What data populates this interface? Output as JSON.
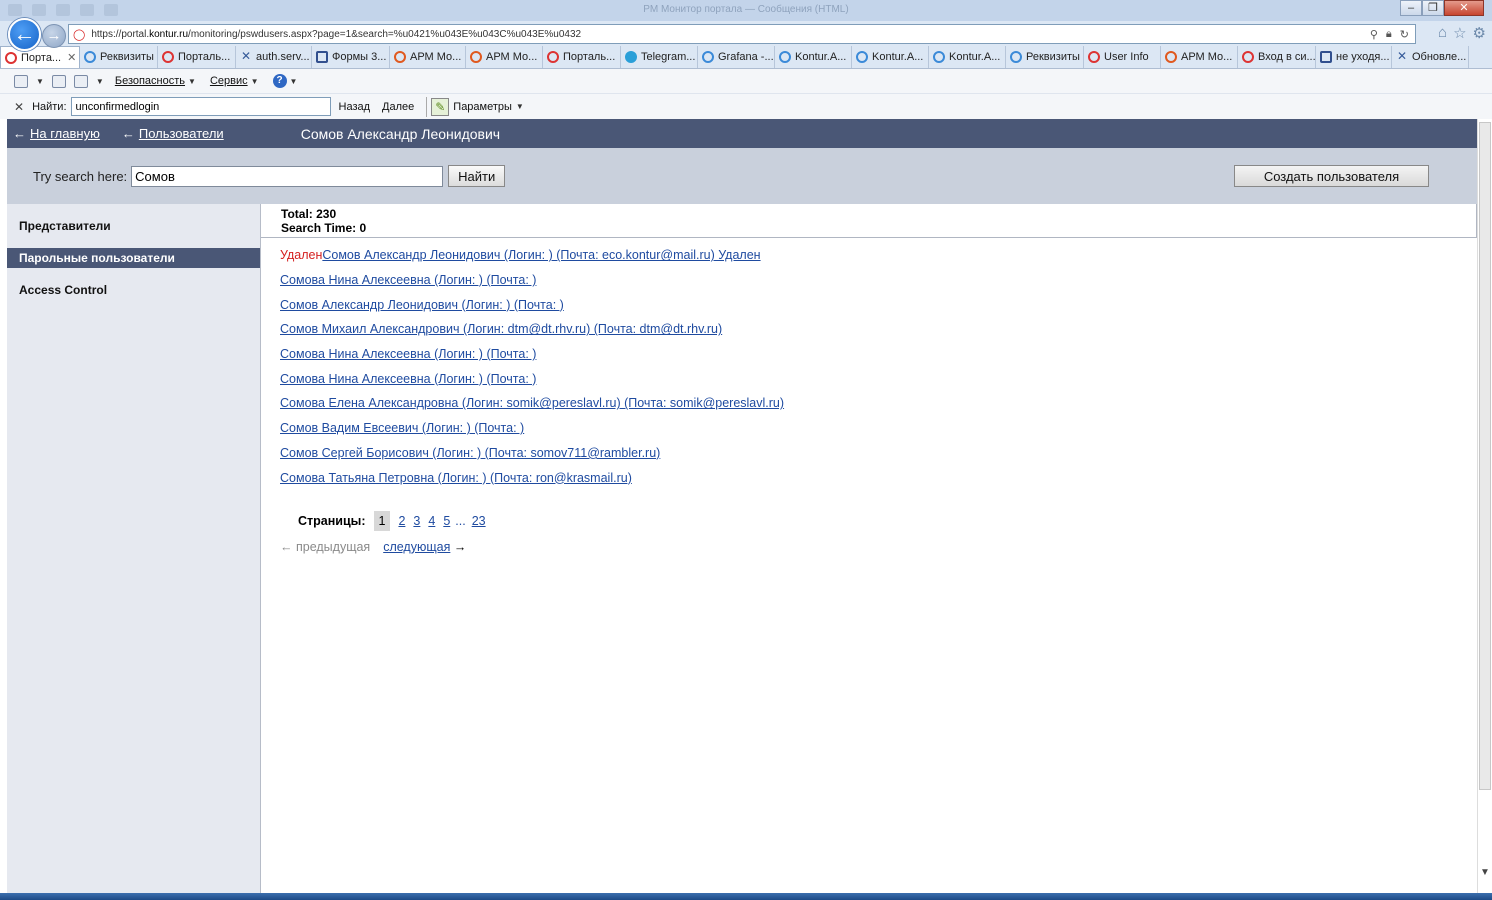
{
  "browser": {
    "window_title": "РМ Монитор портала — Сообщения (HTML)",
    "url_prefix": "https://portal.",
    "url_domain": "kontur.ru",
    "url_path": "/monitoring/pswdusers.aspx?page=1&search=%u0421%u043E%u043C%u043E%u0432",
    "tabs": [
      {
        "label": "Порта...",
        "icon": "portal-icon",
        "active": true
      },
      {
        "label": "Реквизиты",
        "icon": "ie-icon"
      },
      {
        "label": "Порталь...",
        "icon": "portal-icon"
      },
      {
        "label": "auth.serv...",
        "icon": "kontur-x-icon"
      },
      {
        "label": "Формы 3...",
        "icon": "form-icon"
      },
      {
        "label": "АРМ Мо...",
        "icon": "arm-icon"
      },
      {
        "label": "АРМ Мо...",
        "icon": "arm-icon"
      },
      {
        "label": "Порталь...",
        "icon": "portal-icon"
      },
      {
        "label": "Telegram...",
        "icon": "telegram-icon"
      },
      {
        "label": "Grafana -...",
        "icon": "ie-icon"
      },
      {
        "label": "Kontur.A...",
        "icon": "ie-icon"
      },
      {
        "label": "Kontur.A...",
        "icon": "ie-icon"
      },
      {
        "label": "Kontur.A...",
        "icon": "ie-icon"
      },
      {
        "label": "Реквизиты",
        "icon": "ie-icon"
      },
      {
        "label": "User Info",
        "icon": "portal-icon"
      },
      {
        "label": "АРМ Мо...",
        "icon": "arm-icon"
      },
      {
        "label": "Вход в си...",
        "icon": "portal-icon"
      },
      {
        "label": "не уходя...",
        "icon": "form-icon"
      },
      {
        "label": "Обновле...",
        "icon": "kontur-x-icon"
      }
    ],
    "commands": {
      "security": "Безопасность",
      "service": "Сервис"
    },
    "find": {
      "label": "Найти:",
      "value": "unconfirmedlogin",
      "back": "Назад",
      "next": "Далее",
      "params": "Параметры"
    }
  },
  "header": {
    "home_link": "На главную",
    "users_link": "Пользователи",
    "title": "Сомов Александр Леонидович"
  },
  "search": {
    "label": "Try search here:",
    "value": "Сомов",
    "button": "Найти",
    "create_button": "Создать пользователя"
  },
  "sidebar": {
    "items": [
      {
        "label": "Представители",
        "active": false
      },
      {
        "label": "Парольные пользователи",
        "active": true
      },
      {
        "label": "Access Control",
        "active": false
      }
    ]
  },
  "stats": {
    "total": "Total: 230",
    "search_time": "Search Time: 0"
  },
  "results": [
    {
      "deleted_prefix": "Удален",
      "text": "Сомов Александр Леонидович (Логин: ) (Почта: eco.kontur@mail.ru) Удален"
    },
    {
      "deleted_prefix": "",
      "text": "Сомова Нина Алексеевна (Логин: ) (Почта: )"
    },
    {
      "deleted_prefix": "",
      "text": "Сомов Александр Леонидович (Логин: ) (Почта: )"
    },
    {
      "deleted_prefix": "",
      "text": "Сомов Михаил Александрович (Логин: dtm@dt.rhv.ru) (Почта: dtm@dt.rhv.ru)"
    },
    {
      "deleted_prefix": "",
      "text": "Сомова Нина Алексеевна (Логин: ) (Почта: )"
    },
    {
      "deleted_prefix": "",
      "text": "Сомова Нина Алексеевна (Логин: ) (Почта: )"
    },
    {
      "deleted_prefix": "",
      "text": "Сомова Елена Александровна (Логин: somik@pereslavl.ru) (Почта: somik@pereslavl.ru)"
    },
    {
      "deleted_prefix": "",
      "text": "Сомов Вадим Евсеевич (Логин: ) (Почта: )"
    },
    {
      "deleted_prefix": "",
      "text": "Сомов Сергей Борисович (Логин: ) (Почта: somov711@rambler.ru)"
    },
    {
      "deleted_prefix": "",
      "text": "Сомова Татьяна Петровна (Логин: ) (Почта: ron@krasmail.ru)"
    }
  ],
  "pager": {
    "label": "Страницы:",
    "current": "1",
    "pages": [
      "2",
      "3",
      "4",
      "5"
    ],
    "ellipsis": "...",
    "last": "23",
    "prev": "← предыдущая",
    "next": "следующая",
    "next_arrow": "→"
  },
  "colors": {
    "header_bg": "#4a5776",
    "search_bg": "#c9d0dc",
    "sidebar_bg": "#e6e9f0",
    "link": "#1f4ba0",
    "deleted": "#d42020"
  }
}
